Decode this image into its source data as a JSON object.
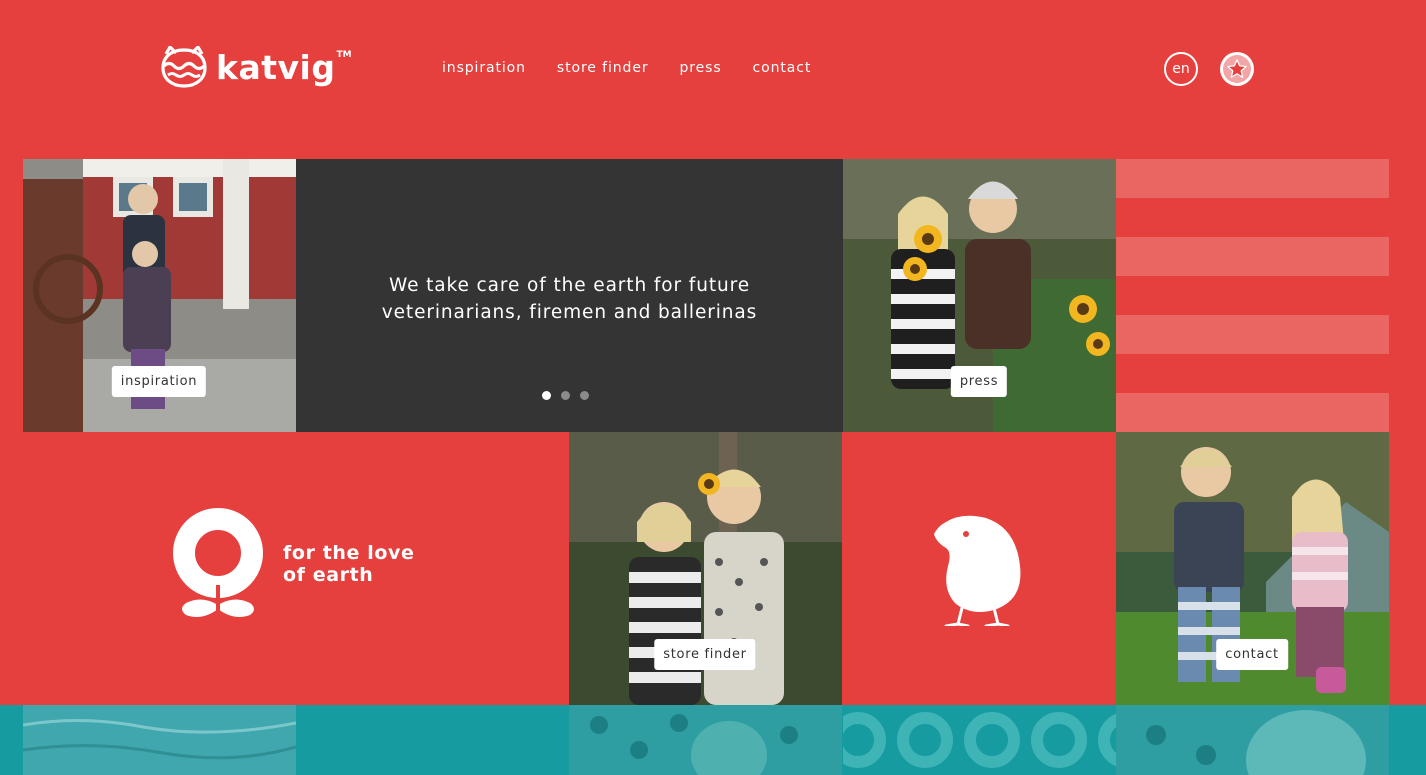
{
  "brand": {
    "name": "katvig",
    "trademark": "TM"
  },
  "nav": {
    "items": [
      {
        "label": "inspiration"
      },
      {
        "label": "store finder"
      },
      {
        "label": "press"
      },
      {
        "label": "contact"
      }
    ]
  },
  "header": {
    "language": "en",
    "badge_icon": "star-icon"
  },
  "tiles": {
    "inspiration_tag": "inspiration",
    "press_tag": "press",
    "store_finder_tag": "store finder",
    "contact_tag": "contact",
    "quote_line1": "We take care of the earth for future",
    "quote_line2": "veterinarians, firemen and ballerinas",
    "love_line1": "for the love",
    "love_line2": "of earth",
    "carousel": {
      "slides": 3,
      "active": 1
    }
  },
  "colors": {
    "brand_red": "#e5403e",
    "stripe_pink": "#ea6662",
    "dark_tile": "#343434",
    "teal": "#169ba0"
  }
}
